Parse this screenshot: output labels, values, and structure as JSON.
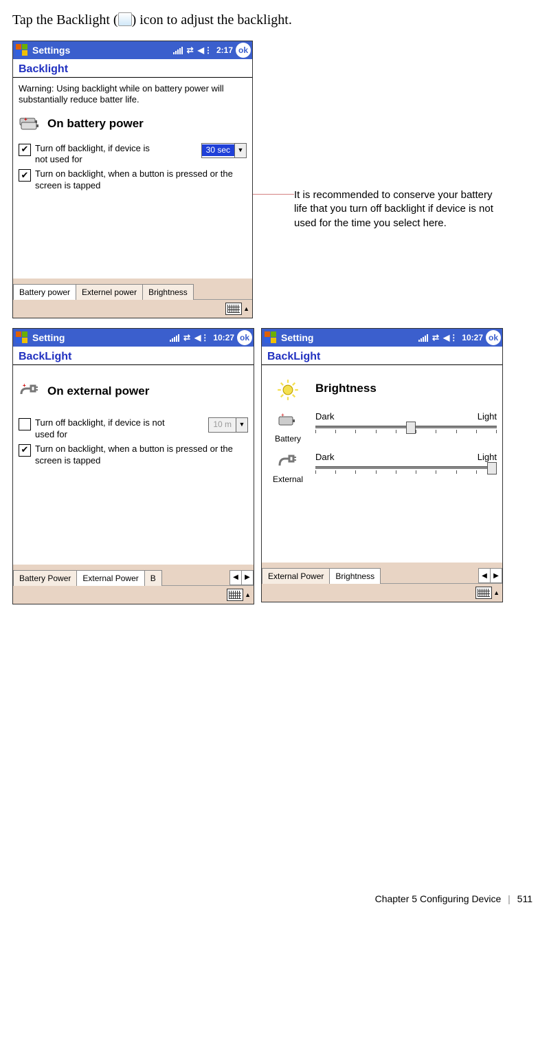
{
  "intro_before": "Tap the Backlight (",
  "intro_after": ") icon to adjust the backlight.",
  "callout": "It is recommended to conserve your battery life that you turn off backlight if device is not used for the time you select here.",
  "shot1": {
    "title": "Settings",
    "time": "2:17",
    "ok": "ok",
    "section": "Backlight",
    "warning": "Warning: Using backlight while on battery power will substantially reduce batter life.",
    "power_label": "On battery power",
    "chk1": "Turn off backlight, if device is not used for",
    "sel1": "30 sec",
    "chk2": "Turn on backlight, when a button is pressed or the screen is tapped",
    "tabs": [
      "Battery power",
      "Externel power",
      "Brightness"
    ]
  },
  "shot2": {
    "title": "Setting",
    "time": "10:27",
    "ok": "ok",
    "section": "BackLight",
    "power_label": "On external power",
    "chk1": "Turn off backlight, if device is not used for",
    "sel1": "10 m",
    "chk2": "Turn on backlight, when a button is pressed or the screen is tapped",
    "tabs": [
      "Battery Power",
      "External Power",
      "B"
    ]
  },
  "shot3": {
    "title": "Setting",
    "time": "10:27",
    "ok": "ok",
    "section": "BackLight",
    "bright_title": "Brightness",
    "row1_label": "Battery",
    "row2_label": "External",
    "range_dark": "Dark",
    "range_light": "Light",
    "tabs": [
      "External Power",
      "Brightness"
    ]
  },
  "footer": {
    "chapter": "Chapter 5",
    "title": "Configuring Device",
    "page": "511"
  }
}
